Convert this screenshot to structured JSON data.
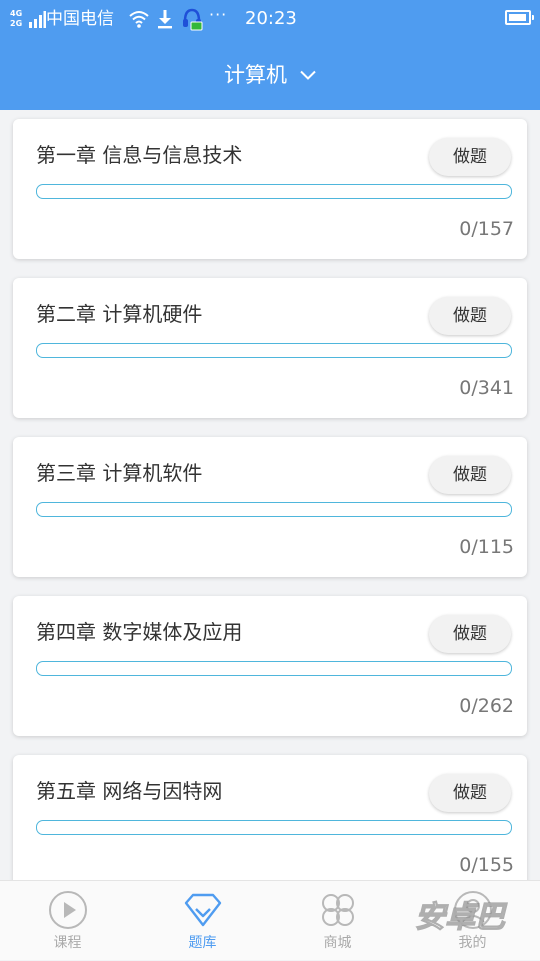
{
  "status_bar": {
    "network_badge_top": "4G",
    "network_badge_bottom": "2G",
    "carrier": "中国电信",
    "time": "20:23",
    "more": "···",
    "battery_level": 0.95,
    "icons": [
      "signal-icon",
      "wifi-icon",
      "download-icon",
      "headset-icon",
      "battery-icon"
    ]
  },
  "header": {
    "subject": "计算机",
    "dropdown_icon": "chevron-down-icon"
  },
  "chapters": [
    {
      "title": "第一章 信息与信息技术",
      "button": "做题",
      "progress": 0,
      "count": "0/157"
    },
    {
      "title": "第二章 计算机硬件",
      "button": "做题",
      "progress": 0,
      "count": "0/341"
    },
    {
      "title": "第三章 计算机软件",
      "button": "做题",
      "progress": 0,
      "count": "0/115"
    },
    {
      "title": "第四章 数字媒体及应用",
      "button": "做题",
      "progress": 0,
      "count": "0/262"
    },
    {
      "title": "第五章 网络与因特网",
      "button": "做题",
      "progress": 0,
      "count": "0/155"
    }
  ],
  "bottom_nav": {
    "active": "题库",
    "items": [
      {
        "label": "课程",
        "icon": "play-circle-icon"
      },
      {
        "label": "题库",
        "icon": "diamond-icon"
      },
      {
        "label": "商城",
        "icon": "grid-icon"
      },
      {
        "label": "我的",
        "icon": "profile-icon"
      }
    ]
  },
  "watermark": {
    "text": "安卓巴"
  },
  "colors": {
    "header": "#4f9cf0",
    "progress": "#4fb6dc",
    "active_tab": "#4f9cf0",
    "inactive_tab": "#aaaaaa",
    "background": "#f2f3f5"
  }
}
